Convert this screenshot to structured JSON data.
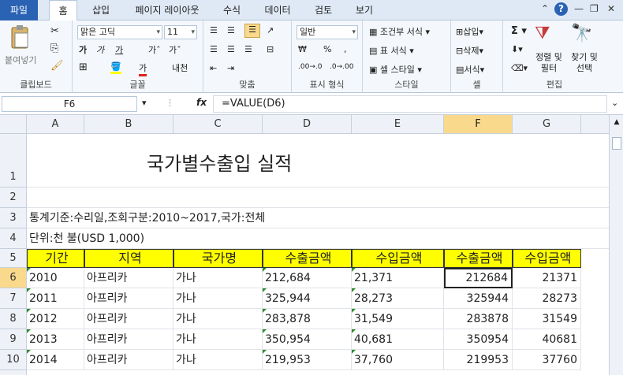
{
  "tabs": [
    "파일",
    "홈",
    "삽입",
    "페이지 레이아웃",
    "수식",
    "데이터",
    "검토",
    "보기"
  ],
  "ribbon": {
    "clipboard": {
      "paste": "붙여넣기",
      "label": "클립보드"
    },
    "font": {
      "name": "맑은 고딕",
      "size": "11",
      "label": "글꼴"
    },
    "align": {
      "label": "맞춤"
    },
    "number": {
      "format": "일반",
      "label": "표시 형식"
    },
    "styles": {
      "cond": "조건부 서식",
      "table": "표 서식",
      "cell": "셀 스타일",
      "label": "스타일"
    },
    "cells": {
      "insert": "삽입",
      "delete": "삭제",
      "format": "서식",
      "label": "셀"
    },
    "edit": {
      "sort": "정렬 및 필터",
      "find": "찾기 및 선택",
      "label": "편집"
    }
  },
  "formula_bar": {
    "cell_ref": "F6",
    "fx": "fx",
    "formula": "=VALUE(D6)"
  },
  "columns": [
    "A",
    "B",
    "C",
    "D",
    "E",
    "F",
    "G"
  ],
  "rows": [
    "1",
    "2",
    "3",
    "4",
    "5",
    "6",
    "7",
    "8",
    "9",
    "10"
  ],
  "sheet": {
    "title": "국가별수출입 실적",
    "info1": "통계기준:수리일,조회구분:2010~2017,국가:전체",
    "info2": "단위:천 불(USD 1,000)",
    "headers": [
      "기간",
      "지역",
      "국가명",
      "수출금액",
      "수입금액",
      "수출금액",
      "수입금액"
    ],
    "data": [
      [
        "2010",
        "아프리카",
        "가나",
        "212,684",
        "21,371",
        "212684",
        "21371"
      ],
      [
        "2011",
        "아프리카",
        "가나",
        "325,944",
        "28,273",
        "325944",
        "28273"
      ],
      [
        "2012",
        "아프리카",
        "가나",
        "283,878",
        "31,549",
        "283878",
        "31549"
      ],
      [
        "2013",
        "아프리카",
        "가나",
        "350,954",
        "40,681",
        "350954",
        "40681"
      ],
      [
        "2014",
        "아프리카",
        "가나",
        "219,953",
        "37,760",
        "219953",
        "37760"
      ]
    ]
  }
}
